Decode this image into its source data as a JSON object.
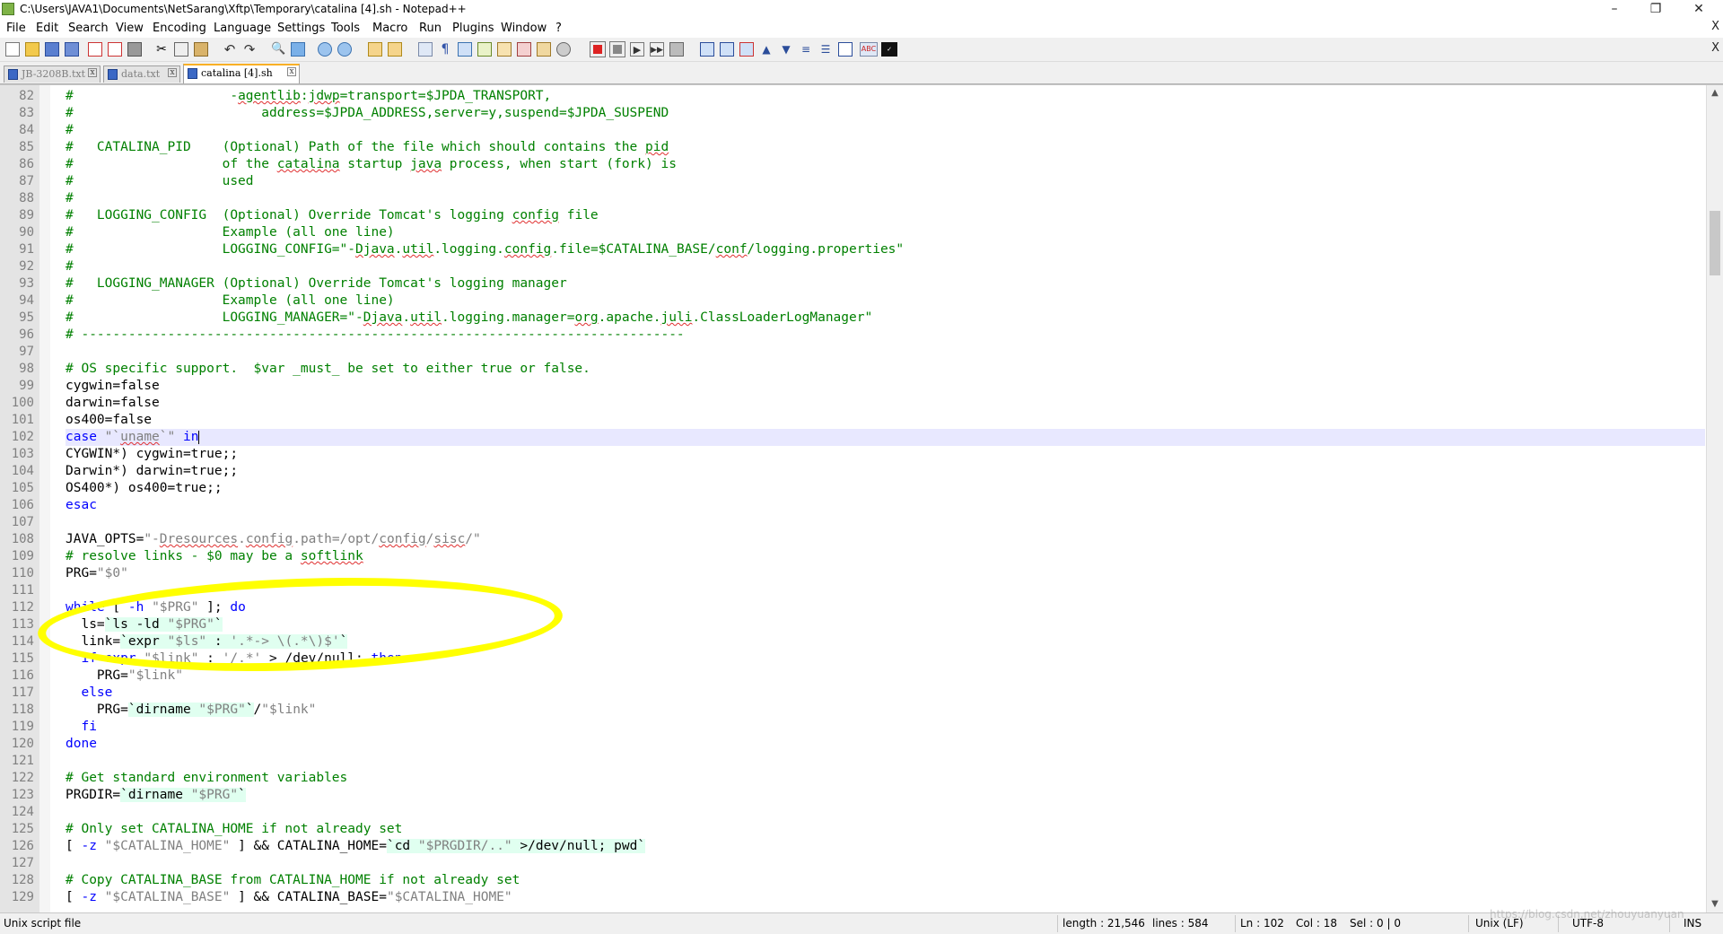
{
  "window": {
    "title": "C:\\Users\\JAVA1\\Documents\\NetSarang\\Xftp\\Temporary\\catalina [4].sh - Notepad++",
    "minimize": "–",
    "maximize": "❐",
    "close": "✕"
  },
  "menu": {
    "items": [
      "File",
      "Edit",
      "Search",
      "View",
      "Encoding",
      "Language",
      "Settings",
      "Tools",
      "Macro",
      "Run",
      "Plugins",
      "Window",
      "?"
    ],
    "close_x": "X"
  },
  "toolbar": {
    "icons": [
      "new-file-icon",
      "open-file-icon",
      "save-icon",
      "save-all-icon",
      "close-icon",
      "close-all-icon",
      "print-icon",
      "cut-icon",
      "copy-icon",
      "paste-icon",
      "undo-icon",
      "redo-icon",
      "find-icon",
      "replace-icon",
      "zoom-in-icon",
      "zoom-out-icon",
      "sync-vertical-icon",
      "sync-horizontal-icon",
      "word-wrap-icon",
      "show-all-chars-icon",
      "indent-guide-icon",
      "user-lang-icon",
      "doc-map-icon",
      "function-list-icon",
      "folder-workspace-icon",
      "monitor-icon",
      "record-macro-icon",
      "stop-macro-icon",
      "play-macro-icon",
      "run-macro-multiple-icon",
      "save-macro-icon",
      "trim-icon",
      "fold-icon",
      "unfold-icon",
      "up-icon",
      "down-icon",
      "collapse-icon",
      "expand-icon",
      "spellcheck-icon",
      "abc-icon"
    ],
    "close_x": "X"
  },
  "tabs": [
    {
      "label": "JB-3208B.txt",
      "active": false
    },
    {
      "label": "data.txt",
      "active": false
    },
    {
      "label": "catalina [4].sh",
      "active": true
    }
  ],
  "editor": {
    "current_line": 102,
    "lines": [
      {
        "n": "82",
        "html": "<span class=\"cm\">#                    -<span class=\"squig\">agentlib</span>:<span class=\"squig\">jdwp</span>=transport=$JPDA_TRANSPORT,</span>"
      },
      {
        "n": "83",
        "html": "<span class=\"cm\">#                        address=$JPDA_ADDRESS,server=y,suspend=$JPDA_SUSPEND</span>"
      },
      {
        "n": "84",
        "html": "<span class=\"cm\">#</span>"
      },
      {
        "n": "85",
        "html": "<span class=\"cm\">#   CATALINA_PID    (Optional) Path of the file which should contains the <span class=\"squig\">pid</span></span>"
      },
      {
        "n": "86",
        "html": "<span class=\"cm\">#                   of the <span class=\"squig\">catalina</span> startup <span class=\"squig\">java</span> process, when start (fork) is</span>"
      },
      {
        "n": "87",
        "html": "<span class=\"cm\">#                   used</span>"
      },
      {
        "n": "88",
        "html": "<span class=\"cm\">#</span>"
      },
      {
        "n": "89",
        "html": "<span class=\"cm\">#   LOGGING_CONFIG  (Optional) Override Tomcat's logging <span class=\"squig\">config</span> file</span>"
      },
      {
        "n": "90",
        "html": "<span class=\"cm\">#                   Example (all one line)</span>"
      },
      {
        "n": "91",
        "html": "<span class=\"cm\">#                   LOGGING_CONFIG=\"-<span class=\"squig\">Djava</span>.<span class=\"squig\">util</span>.logging.<span class=\"squig\">config</span>.file=$CATALINA_BASE/<span class=\"squig\">conf</span>/logging.properties\"</span>"
      },
      {
        "n": "92",
        "html": "<span class=\"cm\">#</span>"
      },
      {
        "n": "93",
        "html": "<span class=\"cm\">#   LOGGING_MANAGER (Optional) Override Tomcat's logging manager</span>"
      },
      {
        "n": "94",
        "html": "<span class=\"cm\">#                   Example (all one line)</span>"
      },
      {
        "n": "95",
        "html": "<span class=\"cm\">#                   LOGGING_MANAGER=\"-<span class=\"squig\">Djava</span>.<span class=\"squig\">util</span>.logging.manager=<span class=\"squig\">org</span>.apache.<span class=\"squig\">juli</span>.ClassLoaderLogManager\"</span>"
      },
      {
        "n": "96",
        "html": "<span class=\"cm\"># -----------------------------------------------------------------------------</span>"
      },
      {
        "n": "97",
        "html": ""
      },
      {
        "n": "98",
        "html": "<span class=\"cm\"># OS specific support.  $var _must_ be set to either true or false.</span>"
      },
      {
        "n": "99",
        "html": "cygwin=false"
      },
      {
        "n": "100",
        "html": "darwin=false"
      },
      {
        "n": "101",
        "html": "os400=false"
      },
      {
        "n": "102",
        "html": "<span class=\"kw\">case</span> <span class=\"st\">\"`<span class=\"squig\">uname</span>`\"</span> <span class=\"kw\">in</span><span class=\"caret\"></span>"
      },
      {
        "n": "103",
        "html": "CYGWIN*) cygwin=true;;"
      },
      {
        "n": "104",
        "html": "Darwin*) darwin=true;;"
      },
      {
        "n": "105",
        "html": "OS400*) os400=true;;"
      },
      {
        "n": "106",
        "html": "<span class=\"kw\">esac</span>"
      },
      {
        "n": "107",
        "html": ""
      },
      {
        "n": "108",
        "html": "JAVA_OPTS=<span class=\"st\">\"-<span class=\"squig\">Dresources</span>.<span class=\"squig\">config</span>.path=/opt/<span class=\"squig\">config</span>/<span class=\"squig\">sisc</span>/\"</span>"
      },
      {
        "n": "109",
        "html": "<span class=\"cm\"># resolve links - $0 may be a <span class=\"squig\">softlink</span></span>"
      },
      {
        "n": "110",
        "html": "PRG=<span class=\"st\">\"$0\"</span>"
      },
      {
        "n": "111",
        "html": ""
      },
      {
        "n": "112",
        "html": "<span class=\"kw\">while</span> [ <span class=\"kw\">-h</span> <span class=\"st\">\"$PRG\"</span> ]; <span class=\"kw\">do</span>"
      },
      {
        "n": "113",
        "html": "  ls=<span class=\"bt\">`ls -ld <span class=\"st\">\"$PRG\"</span>`</span>"
      },
      {
        "n": "114",
        "html": "  link=<span class=\"bt\">`expr <span class=\"st\">\"$ls\"</span> : <span class=\"st\">'.*-&gt; \\(.*\\)$'</span>`</span>"
      },
      {
        "n": "115",
        "html": "  <span class=\"kw\">if</span> <span class=\"kw\">expr</span> <span class=\"st\">\"$link\"</span> : <span class=\"st\">'/.*'</span> &gt; /dev/null; <span class=\"kw\">then</span>"
      },
      {
        "n": "116",
        "html": "    PRG=<span class=\"st\">\"$link\"</span>"
      },
      {
        "n": "117",
        "html": "  <span class=\"kw\">else</span>"
      },
      {
        "n": "118",
        "html": "    PRG=<span class=\"bt\">`dirname <span class=\"st\">\"$PRG\"</span>`</span>/<span class=\"st\">\"$link\"</span>"
      },
      {
        "n": "119",
        "html": "  <span class=\"kw\">fi</span>"
      },
      {
        "n": "120",
        "html": "<span class=\"kw\">done</span>"
      },
      {
        "n": "121",
        "html": ""
      },
      {
        "n": "122",
        "html": "<span class=\"cm\"># Get standard environment variables</span>"
      },
      {
        "n": "123",
        "html": "PRGDIR=<span class=\"bt\">`dirname <span class=\"st\">\"$PRG\"</span>`</span>"
      },
      {
        "n": "124",
        "html": ""
      },
      {
        "n": "125",
        "html": "<span class=\"cm\"># Only set CATALINA_HOME if not already set</span>"
      },
      {
        "n": "126",
        "html": "[ <span class=\"kw\">-z</span> <span class=\"st\">\"$CATALINA_HOME\"</span> ] &amp;&amp; CATALINA_HOME=<span class=\"bt\">`cd <span class=\"st\">\"$PRGDIR/..\"</span> &gt;/dev/null; pwd`</span>"
      },
      {
        "n": "127",
        "html": ""
      },
      {
        "n": "128",
        "html": "<span class=\"cm\"># Copy CATALINA_BASE from CATALINA_HOME if not already set</span>"
      },
      {
        "n": "129",
        "html": "[ <span class=\"kw\">-z</span> <span class=\"st\">\"$CATALINA_BASE\"</span> ] &amp;&amp; CATALINA_BASE=<span class=\"st\">\"$CATALINA_HOME\"</span>"
      }
    ]
  },
  "status": {
    "file_type": "Unix script file",
    "length": "length : 21,546",
    "lines": "lines : 584",
    "ln": "Ln : 102",
    "col": "Col : 18",
    "sel": "Sel : 0 | 0",
    "eol": "Unix (LF)",
    "encoding": "UTF-8",
    "mode": "INS"
  },
  "watermark": "https://blog.csdn.net/zhouyuanyuan",
  "colors": {
    "comment": "#008000",
    "keyword": "#0000ff",
    "string": "#808080",
    "highlight_oval": "#ffff00",
    "current_line": "#e8e8ff"
  }
}
